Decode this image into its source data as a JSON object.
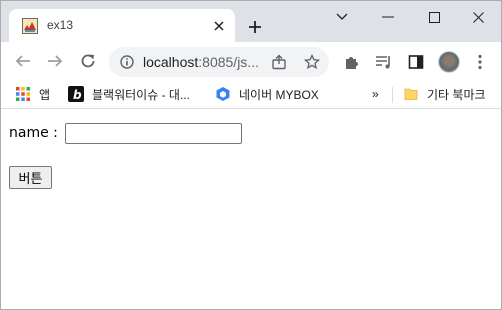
{
  "tab": {
    "title": "ex13",
    "favicon": "page-favicon-icon"
  },
  "toolbar": {
    "url_host": "localhost",
    "url_rest": ":8085/js...",
    "icons": [
      "back-arrow-icon",
      "forward-arrow-icon",
      "reload-icon",
      "site-info-icon",
      "share-icon",
      "bookmark-star-icon",
      "extensions-puzzle-icon",
      "reading-list-icon",
      "side-panel-icon",
      "profile-avatar"
    ]
  },
  "bookmarks": {
    "items": [
      {
        "label": "앱",
        "icon": "apps-grid-icon"
      },
      {
        "label": "블랙워터이슈 - 대...",
        "icon": "b-logo-icon"
      },
      {
        "label": "네이버 MYBOX",
        "icon": "mybox-cube-icon"
      }
    ],
    "overflow": "»",
    "other_folder": "기타 북마크"
  },
  "page": {
    "name_label": "name :",
    "name_value": "",
    "button_label": "버튼"
  },
  "colors": {
    "tabstrip": "#dee1e6",
    "omnibox": "#f1f3f4",
    "text": "#202124"
  }
}
